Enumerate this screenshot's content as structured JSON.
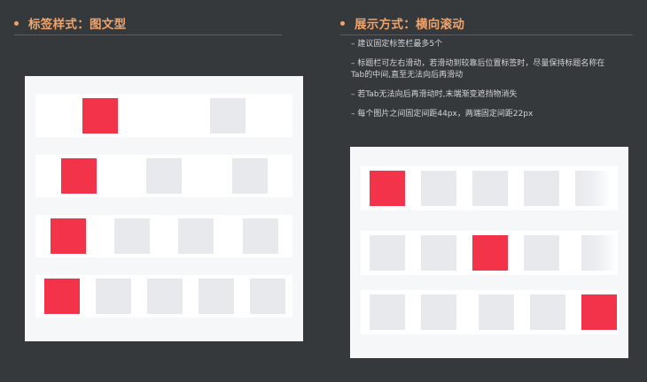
{
  "left_section": {
    "title": "标签样式：图文型"
  },
  "right_section": {
    "title": "展示方式：横向滚动",
    "notes": [
      "– 建议固定标签栏最多5个",
      "– 标题栏可左右滑动，若滑动到较靠后位置标签时，尽量保持标题名称在Tab的中间,直至无法向后再滑动",
      "– 若Tab无法向后再滑动时,末端渐变遮挡物消失",
      "– 每个图片之间固定间距44px，两端固定间距22px"
    ]
  },
  "colors": {
    "background": "#35393c",
    "accent": "#f0a46c",
    "active_tile": "#f23349",
    "inactive_tile": "#e8e9ec",
    "panel": "#f6f7f9"
  },
  "left_panel": {
    "rows": [
      {
        "tiles": 2,
        "active": 0
      },
      {
        "tiles": 3,
        "active": 0
      },
      {
        "tiles": 4,
        "active": 0
      },
      {
        "tiles": 5,
        "active": 0
      }
    ]
  },
  "right_panel": {
    "rows": [
      {
        "tiles": [
          "active",
          "inactive",
          "inactive",
          "inactive",
          "faded"
        ]
      },
      {
        "tiles": [
          "inactive",
          "inactive",
          "active",
          "inactive",
          "faded"
        ]
      },
      {
        "tiles": [
          "inactive",
          "inactive",
          "inactive",
          "inactive",
          "active"
        ]
      }
    ]
  }
}
